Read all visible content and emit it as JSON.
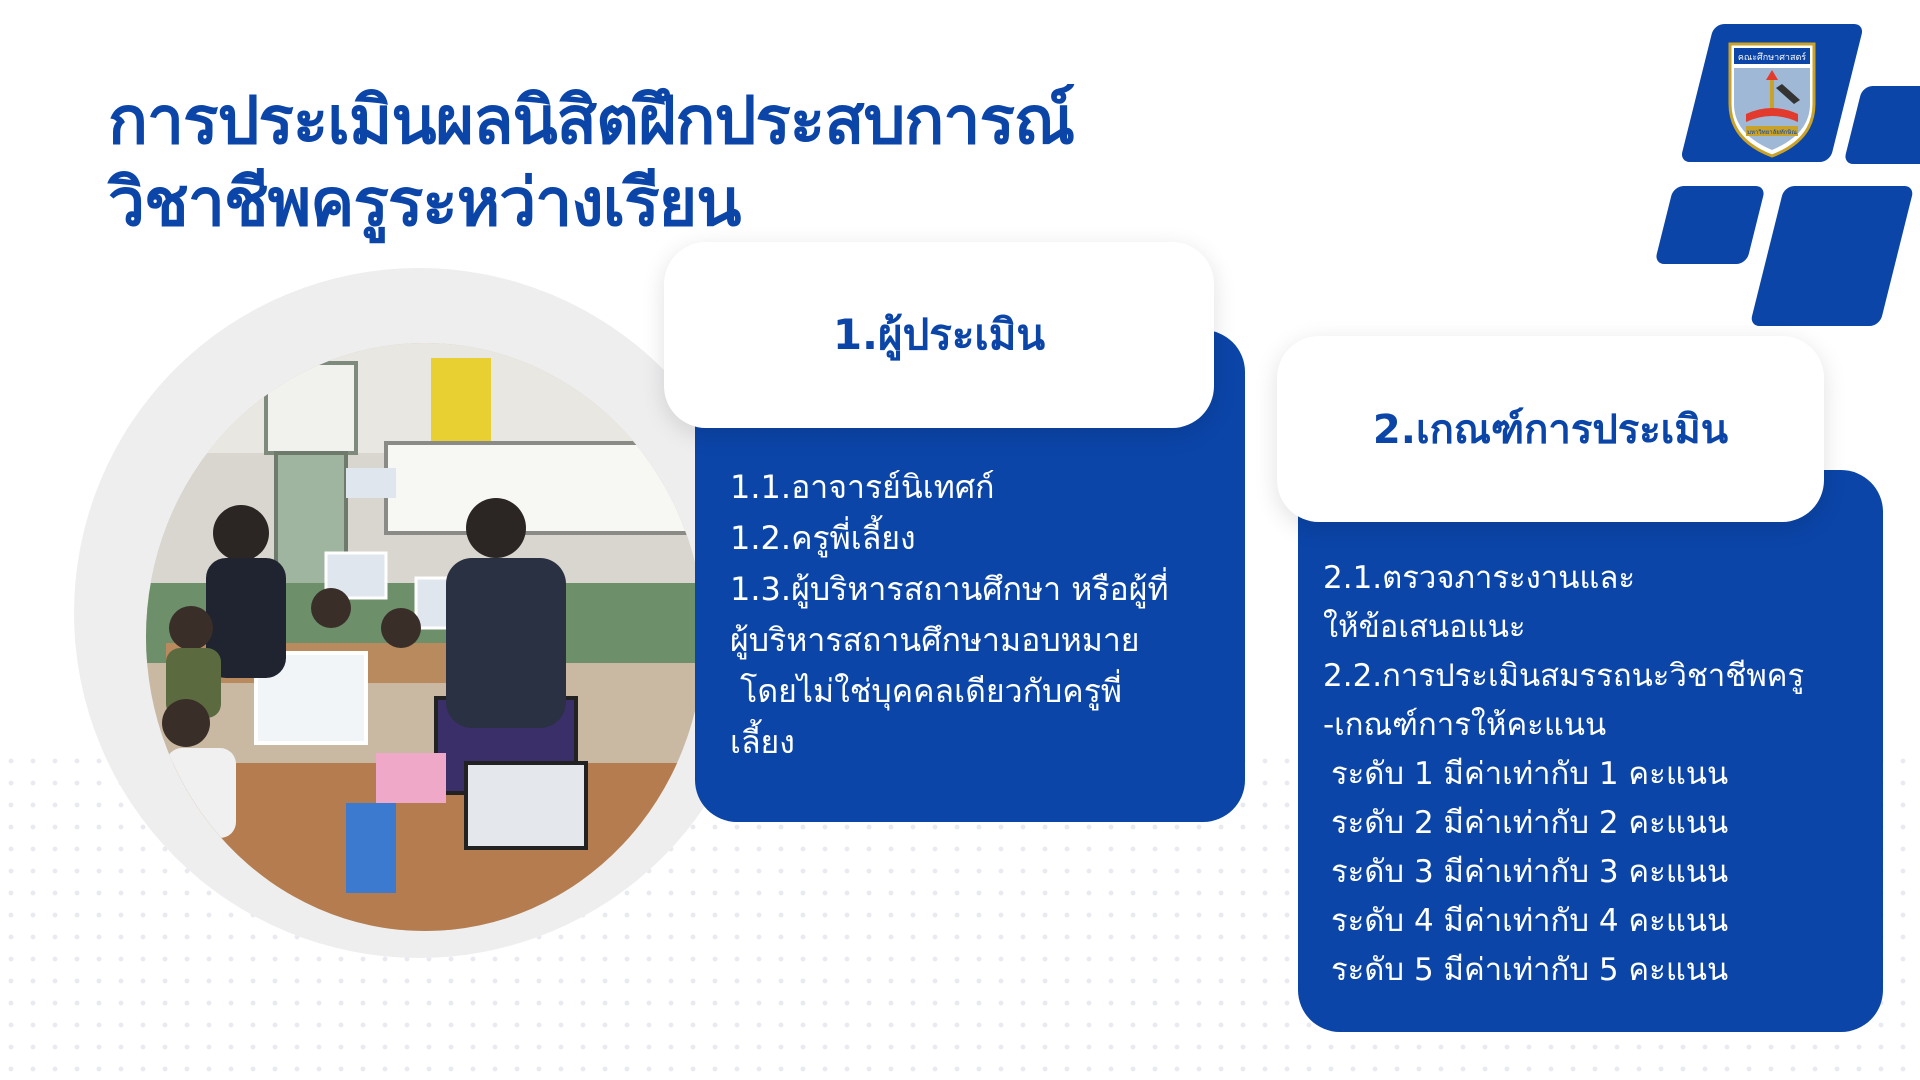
{
  "title": {
    "line1": "การประเมินผลนิสิตฝึกประสบการณ์",
    "line2": "วิชาชีพครูระหว่างเรียน"
  },
  "logo": {
    "top_text": "คณะศึกษาศาสตร์",
    "bottom_text": "มหาวิทยาลัยทักษิณ",
    "icon": "faculty-shield-logo"
  },
  "section1": {
    "heading": "1.ผู้ประเมิน",
    "items": [
      "1.1.อาจารย์นิเทศก์",
      "1.2.ครูพี่เลี้ยง",
      "1.3.ผู้บริหารสถานศึกษา หรือผู้ที่",
      "ผู้บริหารสถานศึกษามอบหมาย",
      " โดยไม่ใช่บุคคลเดียวกับครูพี่",
      "เลี้ยง"
    ]
  },
  "section2": {
    "heading": "2.เกณฑ์การประเมิน",
    "items": [
      "2.1.ตรวจภาระงานและ",
      "ให้ข้อเสนอแนะ",
      "2.2.การประเมินสมรรถนะวิชาชีพครู",
      "-เกณฑ์การให้คะแนน"
    ],
    "levels": [
      "ระดับ 1 มีค่าเท่ากับ 1 คะแนน",
      "ระดับ 2 มีค่าเท่ากับ 2 คะแนน",
      "ระดับ 3 มีค่าเท่ากับ 3 คะแนน",
      "ระดับ 4 มีค่าเท่ากับ 4 คะแนน",
      "ระดับ 5 มีค่าเท่ากับ 5 คะแนน"
    ]
  },
  "colors": {
    "brand_blue": "#0b45a8",
    "panel_white": "#ffffff"
  }
}
